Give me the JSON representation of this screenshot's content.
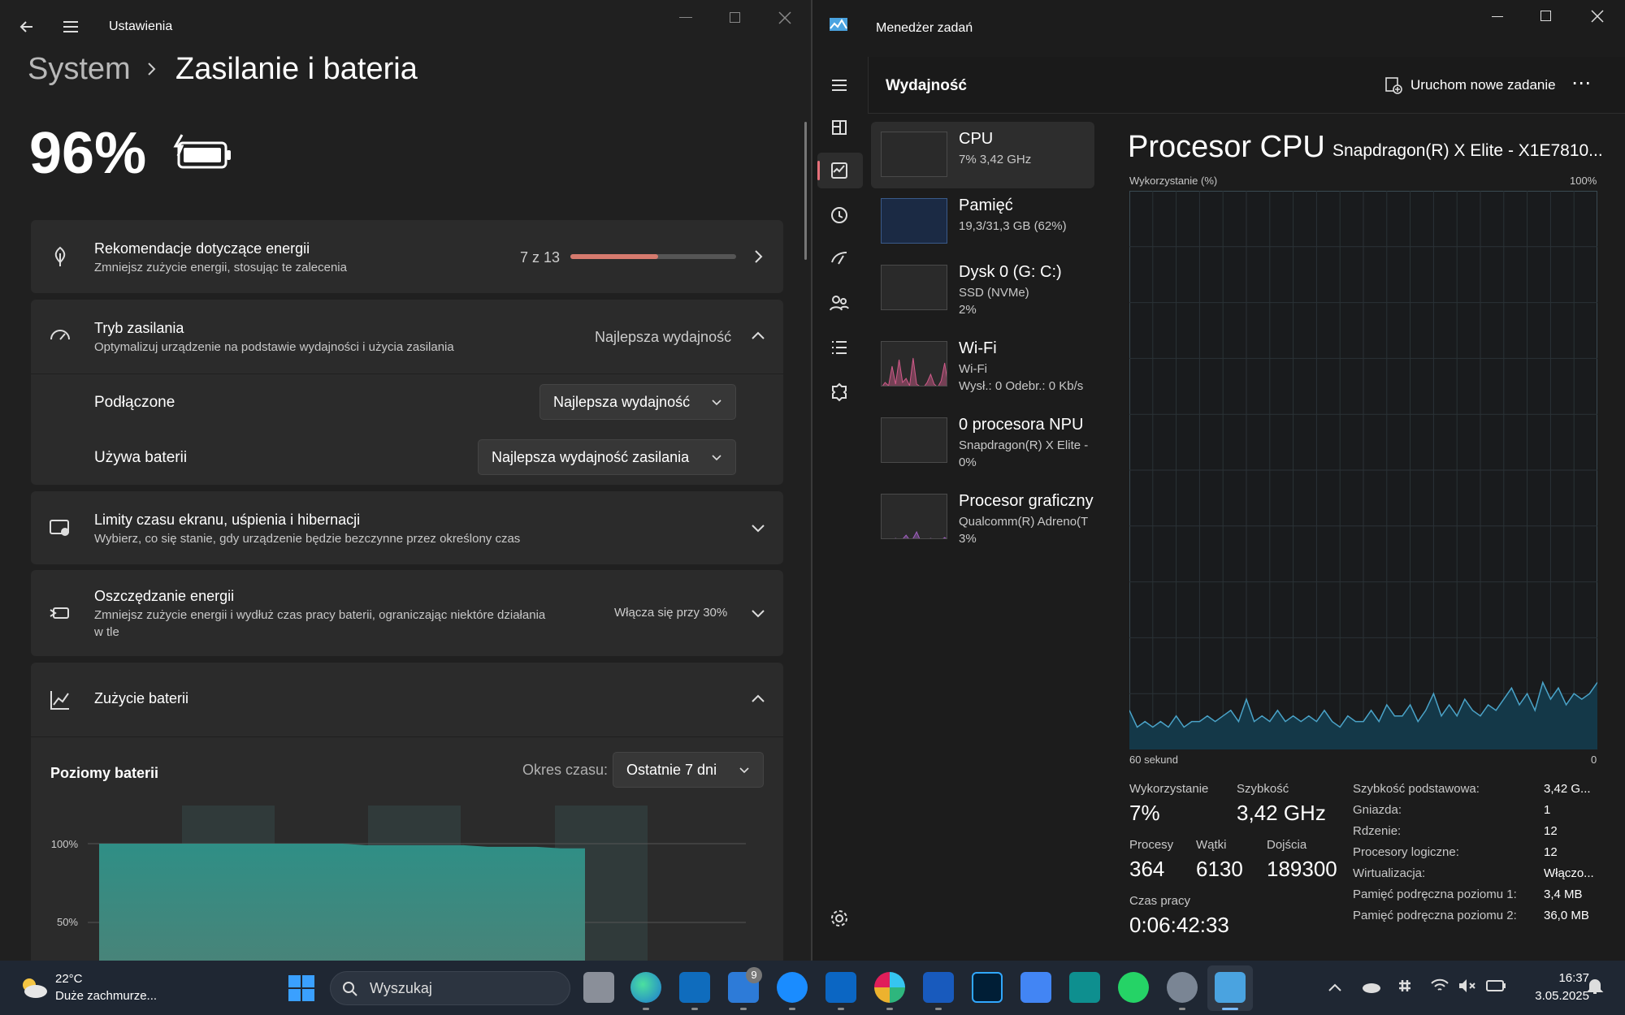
{
  "settings": {
    "window_title": "Ustawienia",
    "breadcrumb": {
      "parent": "System",
      "current": "Zasilanie i bateria"
    },
    "battery_percent": "96%",
    "recommendations": {
      "title": "Rekomendacje dotyczące energii",
      "subtitle": "Zmniejsz zużycie energii, stosując te zalecenia",
      "count": "7 z 13",
      "progress": 0.53
    },
    "power_mode": {
      "title": "Tryb zasilania",
      "subtitle": "Optymalizuj urządzenie na podstawie wydajności i użycia zasilania",
      "value": "Najlepsza wydajność",
      "plugged_label": "Podłączone",
      "plugged_value": "Najlepsza wydajność",
      "battery_label": "Używa baterii",
      "battery_value": "Najlepsza wydajność zasilania"
    },
    "screen_limits": {
      "title": "Limity czasu ekranu, uśpienia i hibernacji",
      "subtitle": "Wybierz, co się stanie, gdy urządzenie będzie bezczynne przez określony czas"
    },
    "energy_saver": {
      "title": "Oszczędzanie energii",
      "subtitle_1": "Zmniejsz zużycie energii i wydłuż czas pracy baterii, ograniczając niektóre działania",
      "subtitle_2": "w tle",
      "value": "Włącza się przy 30%"
    },
    "battery_usage": {
      "title": "Zużycie baterii",
      "levels_title": "Poziomy baterii",
      "period_label": "Okres czasu:",
      "period_value": "Ostatnie 7 dni"
    },
    "chart_data": {
      "type": "area",
      "title": "Poziomy baterii",
      "yticks": [
        "100%",
        "50%"
      ],
      "ylim": [
        0,
        100
      ],
      "x": [
        0,
        1,
        2,
        3,
        4,
        5,
        6,
        7,
        8,
        9,
        10,
        11,
        12,
        13,
        14,
        15,
        16,
        17,
        18,
        19,
        20
      ],
      "values": [
        100,
        100,
        100,
        100,
        100,
        100,
        100,
        100,
        100,
        100,
        100,
        99,
        99,
        99,
        99,
        99,
        98,
        98,
        98,
        97,
        97
      ],
      "colors": {
        "fill_top": "#2f8f86",
        "fill_bottom": "#3b7a70"
      }
    }
  },
  "taskmgr": {
    "window_title": "Menedżer zadań",
    "page_title": "Wydajność",
    "run_task": "Uruchom nowe zadanie",
    "more": "⋯",
    "items": [
      {
        "title": "CPU",
        "sub1": "7% 3,42 GHz",
        "sub2": ""
      },
      {
        "title": "Pamięć",
        "sub1": "19,3/31,3 GB (62%)",
        "sub2": ""
      },
      {
        "title": "Dysk 0 (G: C:)",
        "sub1": "SSD (NVMe)",
        "sub2": "2%"
      },
      {
        "title": "Wi-Fi",
        "sub1": "Wi-Fi",
        "sub2": "Wysł.: 0 Odebr.: 0 Kb/s"
      },
      {
        "title": "0 procesora NPU",
        "sub1": "Snapdragon(R) X Elite -",
        "sub2": "0%"
      },
      {
        "title": "Procesor graficzny",
        "sub1": "Qualcomm(R) Adreno(T",
        "sub2": "3%"
      }
    ],
    "cpu": {
      "heading": "Procesor CPU",
      "model": "Snapdragon(R) X Elite - X1E7810...",
      "usage_label": "Wykorzystanie (%)",
      "max_label": "100%",
      "time_label": "60 sekund",
      "zero_label": "0",
      "chart_data": {
        "type": "area",
        "title": "",
        "ylim": [
          0,
          100
        ],
        "xlim": [
          60,
          0
        ],
        "values": [
          7,
          4,
          5,
          4,
          5,
          4,
          6,
          4,
          5,
          5,
          6,
          5,
          6,
          7,
          5,
          9,
          5,
          6,
          5,
          7,
          5,
          6,
          5,
          6,
          5,
          7,
          5,
          4,
          6,
          5,
          5,
          7,
          5,
          8,
          6,
          6,
          8,
          5,
          7,
          10,
          6,
          8,
          6,
          9,
          7,
          6,
          8,
          7,
          9,
          11,
          8,
          10,
          7,
          12,
          9,
          11,
          8,
          10,
          9,
          10,
          12
        ],
        "colors": {
          "line": "#4aa3c8",
          "fill": "#14384a"
        }
      },
      "stats": {
        "usage_label": "Wykorzystanie",
        "usage": "7%",
        "speed_label": "Szybkość",
        "speed": "3,42 GHz",
        "procs_label": "Procesy",
        "procs": "364",
        "threads_label": "Wątki",
        "threads": "6130",
        "handles_label": "Dojścia",
        "handles": "189300",
        "uptime_label": "Czas pracy",
        "uptime": "0:06:42:33"
      },
      "details": [
        {
          "k": "Szybkość podstawowa:",
          "v": "3,42 G..."
        },
        {
          "k": "Gniazda:",
          "v": "1"
        },
        {
          "k": "Rdzenie:",
          "v": "12"
        },
        {
          "k": "Procesory logiczne:",
          "v": "12"
        },
        {
          "k": "Wirtualizacja:",
          "v": "Włączo..."
        },
        {
          "k": "Pamięć podręczna poziomu 1:",
          "v": "3,4 MB"
        },
        {
          "k": "Pamięć podręczna poziomu 2:",
          "v": "36,0 MB"
        }
      ]
    }
  },
  "taskbar": {
    "weather_temp": "22°C",
    "weather_desc": "Duże zachmurze...",
    "search_placeholder": "Wyszukaj",
    "badge": "9",
    "time": "16:37",
    "date": "3.05.2025"
  }
}
